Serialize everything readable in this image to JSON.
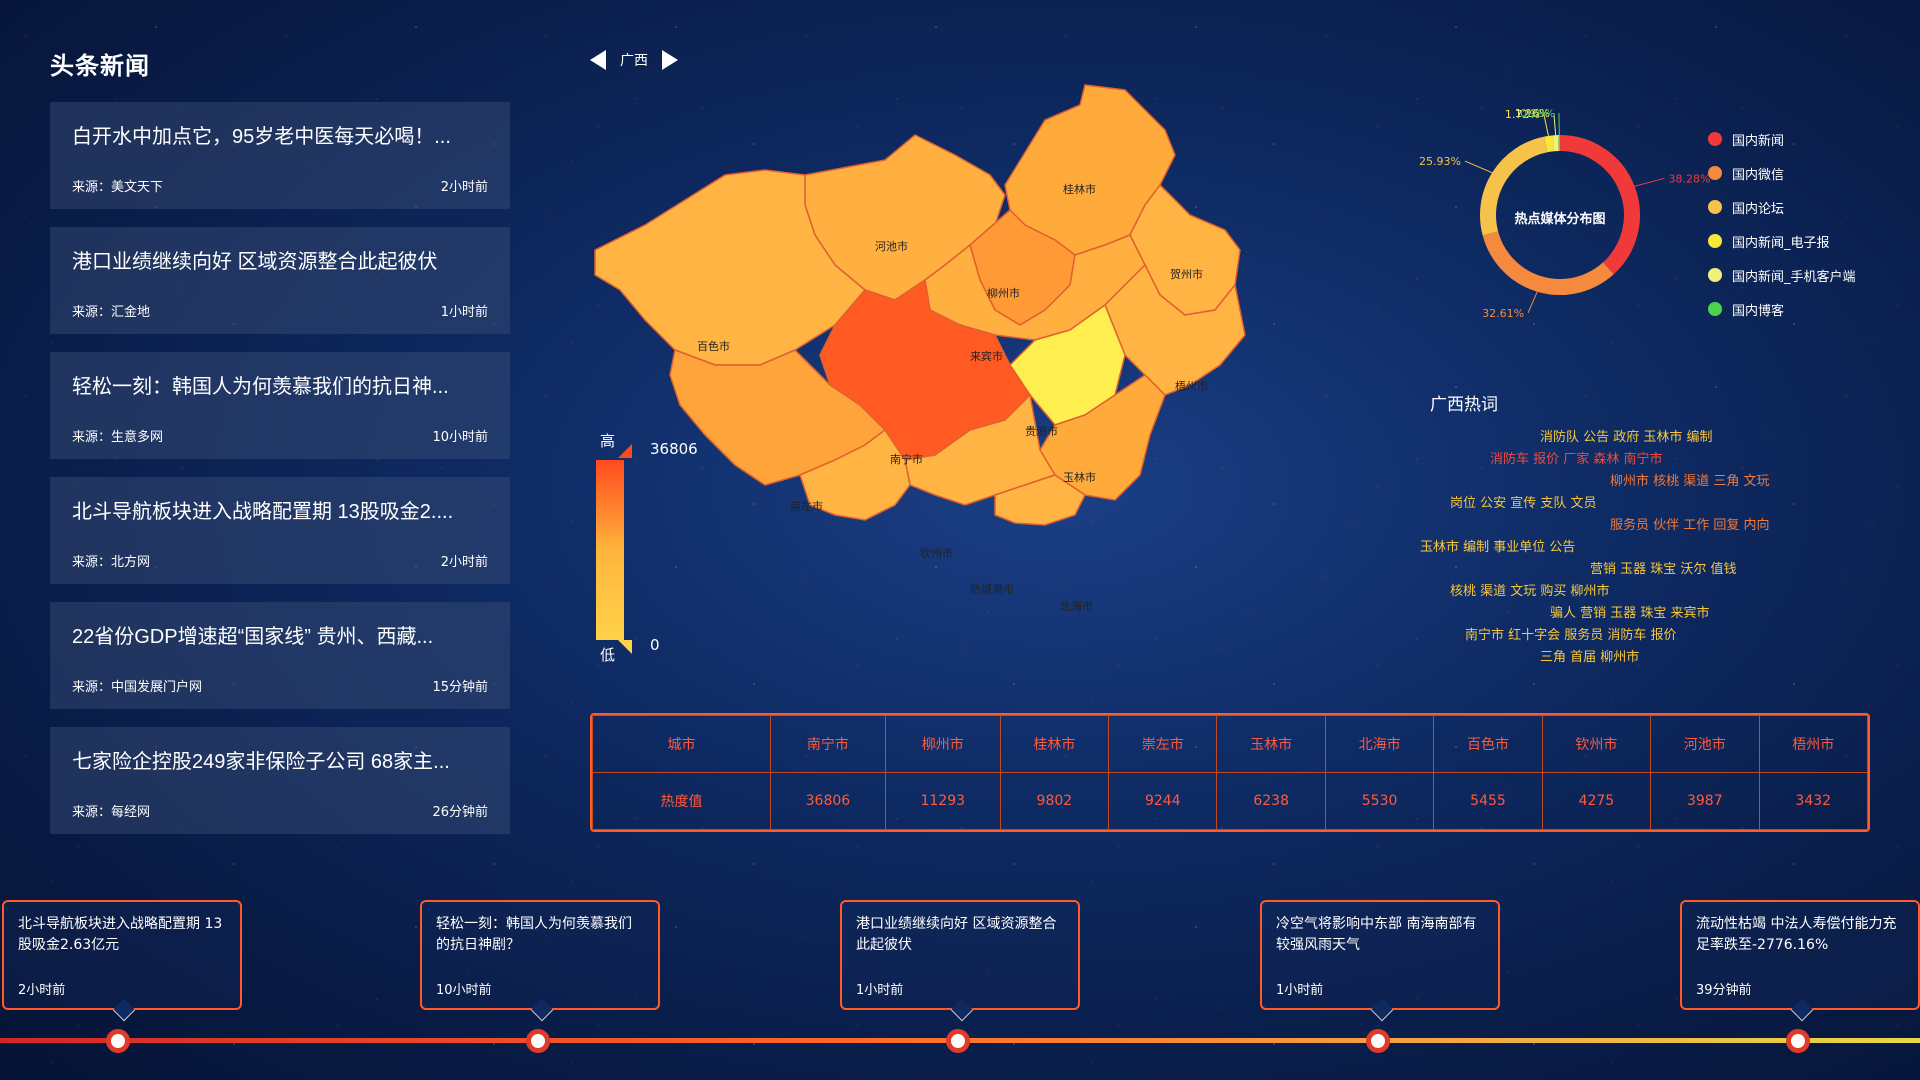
{
  "news": {
    "title": "头条新闻",
    "items": [
      {
        "headline": "白开水中加点它，95岁老中医每天必喝！...",
        "source": "来源：美文天下",
        "time": "2小时前"
      },
      {
        "headline": "港口业绩继续向好 区域资源整合此起彼伏",
        "source": "来源：汇金地",
        "time": "1小时前"
      },
      {
        "headline": "轻松一刻：韩国人为何羡慕我们的抗日神...",
        "source": "来源：生意多网",
        "time": "10小时前"
      },
      {
        "headline": "北斗导航板块进入战略配置期 13股吸金2....",
        "source": "来源：北方网",
        "time": "2小时前"
      },
      {
        "headline": "22省份GDP增速超“国家线” 贵州、西藏...",
        "source": "来源：中国发展门户网",
        "time": "15分钟前"
      },
      {
        "headline": "七家险企控股249家非保险子公司 68家主...",
        "source": "来源：每经网",
        "time": "26分钟前"
      }
    ]
  },
  "province": {
    "name": "广西"
  },
  "map": {
    "cities": [
      "桂林市",
      "河池市",
      "柳州市",
      "贺州市",
      "百色市",
      "来宾市",
      "梧州市",
      "贵港市",
      "南宁市",
      "玉林市",
      "崇左市",
      "钦州市",
      "防城港市",
      "北海市"
    ]
  },
  "legend": {
    "high_label": "高",
    "low_label": "低",
    "max": "36806",
    "min": "0"
  },
  "donut": {
    "title": "热点媒体分布图",
    "colors": {
      "国内新闻": "#f03a3a",
      "国内微信": "#f58a3e",
      "国内论坛": "#f7c24a",
      "国内新闻_电子报": "#f5e83a",
      "国内新闻_手机客户端": "#f0f07a",
      "国内博客": "#4cd44c"
    }
  },
  "chart_data": {
    "type": "pie",
    "title": "热点媒体分布图",
    "categories": [
      "国内新闻",
      "国内微信",
      "国内论坛",
      "国内新闻_电子报",
      "国内新闻_手机客户端",
      "国内博客"
    ],
    "values": [
      38.28,
      32.61,
      25.93,
      1.72,
      1.16,
      0.29
    ],
    "labels": [
      "38.28%",
      "32.61%",
      "25.93%",
      "1.72%",
      "1.16%",
      "0.29%"
    ],
    "legend_position": "right"
  },
  "hot": {
    "title": "广西热词",
    "lines": [
      {
        "text": "消防队 公告 政府 玉林市 编制",
        "color": "#f7c83a",
        "indent": 130
      },
      {
        "text": "消防车 报价 厂家 森林 南宁市",
        "color": "#f04a3a",
        "indent": 80
      },
      {
        "text": "柳州市 核桃 渠道 三角 文玩",
        "color": "#f07a3a",
        "indent": 200
      },
      {
        "text": "岗位 公安 宣传 支队 文员",
        "color": "#f7c83a",
        "indent": 40
      },
      {
        "text": "服务员 伙伴 工作 回复 内向",
        "color": "#f07a3a",
        "indent": 200
      },
      {
        "text": "玉林市 编制 事业单位 公告",
        "color": "#f7c83a",
        "indent": 10
      },
      {
        "text": "营销 玉器 珠宝 沃尔 值钱",
        "color": "#f7c83a",
        "indent": 180
      },
      {
        "text": "核桃 渠道 文玩 购买 柳州市",
        "color": "#f7c83a",
        "indent": 40
      },
      {
        "text": "骗人 营销 玉器 珠宝 来宾市",
        "color": "#f7c83a",
        "indent": 140
      },
      {
        "text": "南宁市 红十字会 服务员 消防车 报价",
        "color": "#f7c83a",
        "indent": 55
      },
      {
        "text": "三角 首届 柳州市",
        "color": "#f7c83a",
        "indent": 130
      }
    ]
  },
  "table": {
    "header_label": "城市",
    "value_label": "热度值",
    "cities": [
      "南宁市",
      "柳州市",
      "桂林市",
      "崇左市",
      "玉林市",
      "北海市",
      "百色市",
      "钦州市",
      "河池市",
      "梧州市"
    ],
    "values": [
      "36806",
      "11293",
      "9802",
      "9244",
      "6238",
      "5530",
      "5455",
      "4275",
      "3987",
      "3432"
    ]
  },
  "timeline": [
    {
      "text": "北斗导航板块进入战略配置期 13股吸金2.63亿元",
      "time": "2小时前"
    },
    {
      "text": "轻松一刻：韩国人为何羡慕我们的抗日神剧？",
      "time": "10小时前"
    },
    {
      "text": "港口业绩继续向好 区域资源整合此起彼伏",
      "time": "1小时前"
    },
    {
      "text": "冷空气将影响中东部 南海南部有较强风雨天气",
      "time": "1小时前"
    },
    {
      "text": "流动性枯竭 中法人寿偿付能力充足率跌至-2776.16%",
      "time": "39分钟前"
    }
  ]
}
